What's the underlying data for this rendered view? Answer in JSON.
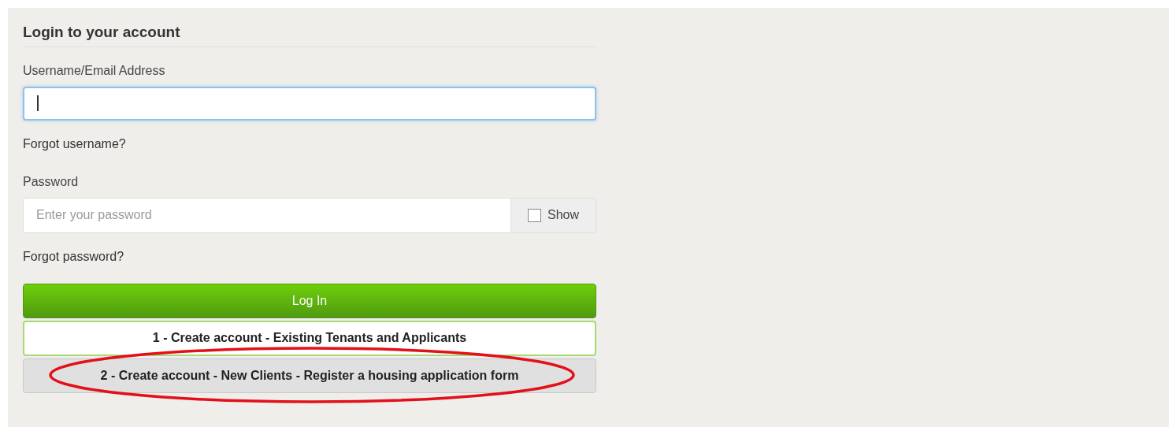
{
  "title": "Login to your account",
  "username": {
    "label": "Username/Email Address",
    "focused": true
  },
  "forgot_username": "Forgot username?",
  "password": {
    "label": "Password",
    "placeholder": "Enter your password",
    "show_label": "Show",
    "show_checked": false
  },
  "forgot_password": "Forgot password?",
  "buttons": [
    {
      "label": "Log In",
      "kind": "primary",
      "circled": false
    },
    {
      "label": "1 - Create account - Existing Tenants and Applicants",
      "kind": "outline",
      "circled": false
    },
    {
      "label": "2 - Create account - New Clients - Register a housing application form",
      "kind": "secondary",
      "circled": true
    }
  ]
}
